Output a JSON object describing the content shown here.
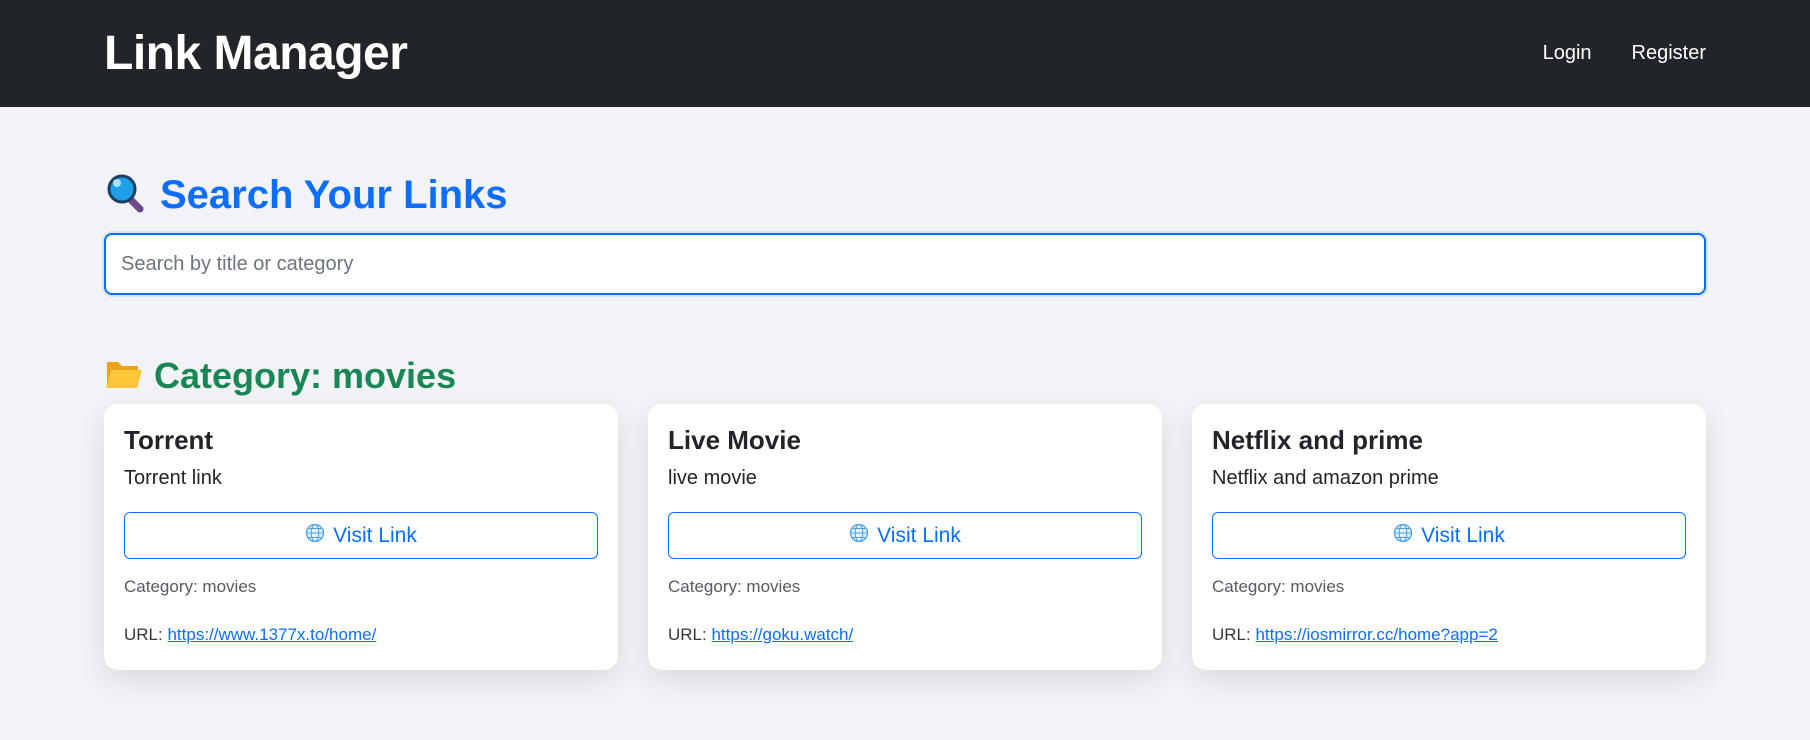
{
  "navbar": {
    "brand": "Link Manager",
    "login_label": "Login",
    "register_label": "Register"
  },
  "search": {
    "heading_icon": "magnifying-glass-icon",
    "heading": "Search Your Links",
    "placeholder": "Search by title or category",
    "value": ""
  },
  "category": {
    "icon": "open-folder-icon",
    "heading": "Category: movies"
  },
  "cards": [
    {
      "title": "Torrent",
      "description": "Torrent link",
      "button_icon": "globe-icon",
      "button_label": "Visit Link",
      "category": "Category: movies",
      "url_label": "URL:",
      "url": "https://www.1377x.to/home/"
    },
    {
      "title": "Live Movie",
      "description": "live movie",
      "button_icon": "globe-icon",
      "button_label": "Visit Link",
      "category": "Category: movies",
      "url_label": "URL:",
      "url": "https://goku.watch/"
    },
    {
      "title": "Netflix and prime",
      "description": "Netflix and amazon prime",
      "button_icon": "globe-icon",
      "button_label": "Visit Link",
      "category": "Category: movies",
      "url_label": "URL:",
      "url": "https://iosmirror.cc/home?app=2"
    }
  ],
  "colors": {
    "navbar_bg": "#212529",
    "primary": "#0d6efd",
    "category_green": "#198754",
    "page_bg": "#f1f3f6"
  }
}
